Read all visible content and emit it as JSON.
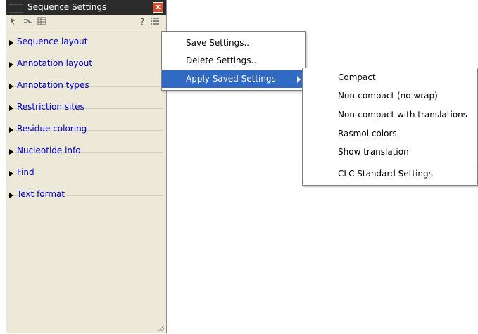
{
  "panel": {
    "title": "Sequence Settings",
    "close_glyph": "x",
    "help_glyph": "?",
    "sections": [
      {
        "label": "Sequence layout"
      },
      {
        "label": "Annotation layout"
      },
      {
        "label": "Annotation types"
      },
      {
        "label": "Restriction sites"
      },
      {
        "label": "Residue coloring"
      },
      {
        "label": "Nucleotide info"
      },
      {
        "label": "Find"
      },
      {
        "label": "Text format"
      }
    ]
  },
  "menu": {
    "items": [
      {
        "label": "Save Settings.."
      },
      {
        "label": "Delete Settings.."
      },
      {
        "label": "Apply Saved Settings"
      }
    ]
  },
  "submenu": {
    "items": [
      {
        "label": "Compact"
      },
      {
        "label": "Non-compact (no wrap)"
      },
      {
        "label": "Non-compact with translations"
      },
      {
        "label": "Rasmol colors"
      },
      {
        "label": "Show translation"
      },
      {
        "label": "CLC Standard Settings"
      }
    ]
  },
  "colors": {
    "selection": "#316ac5",
    "link": "#0000cc",
    "panel_bg": "#ece9d8",
    "title_bg": "#2b2b2b",
    "close_bg": "#e04a2a"
  }
}
